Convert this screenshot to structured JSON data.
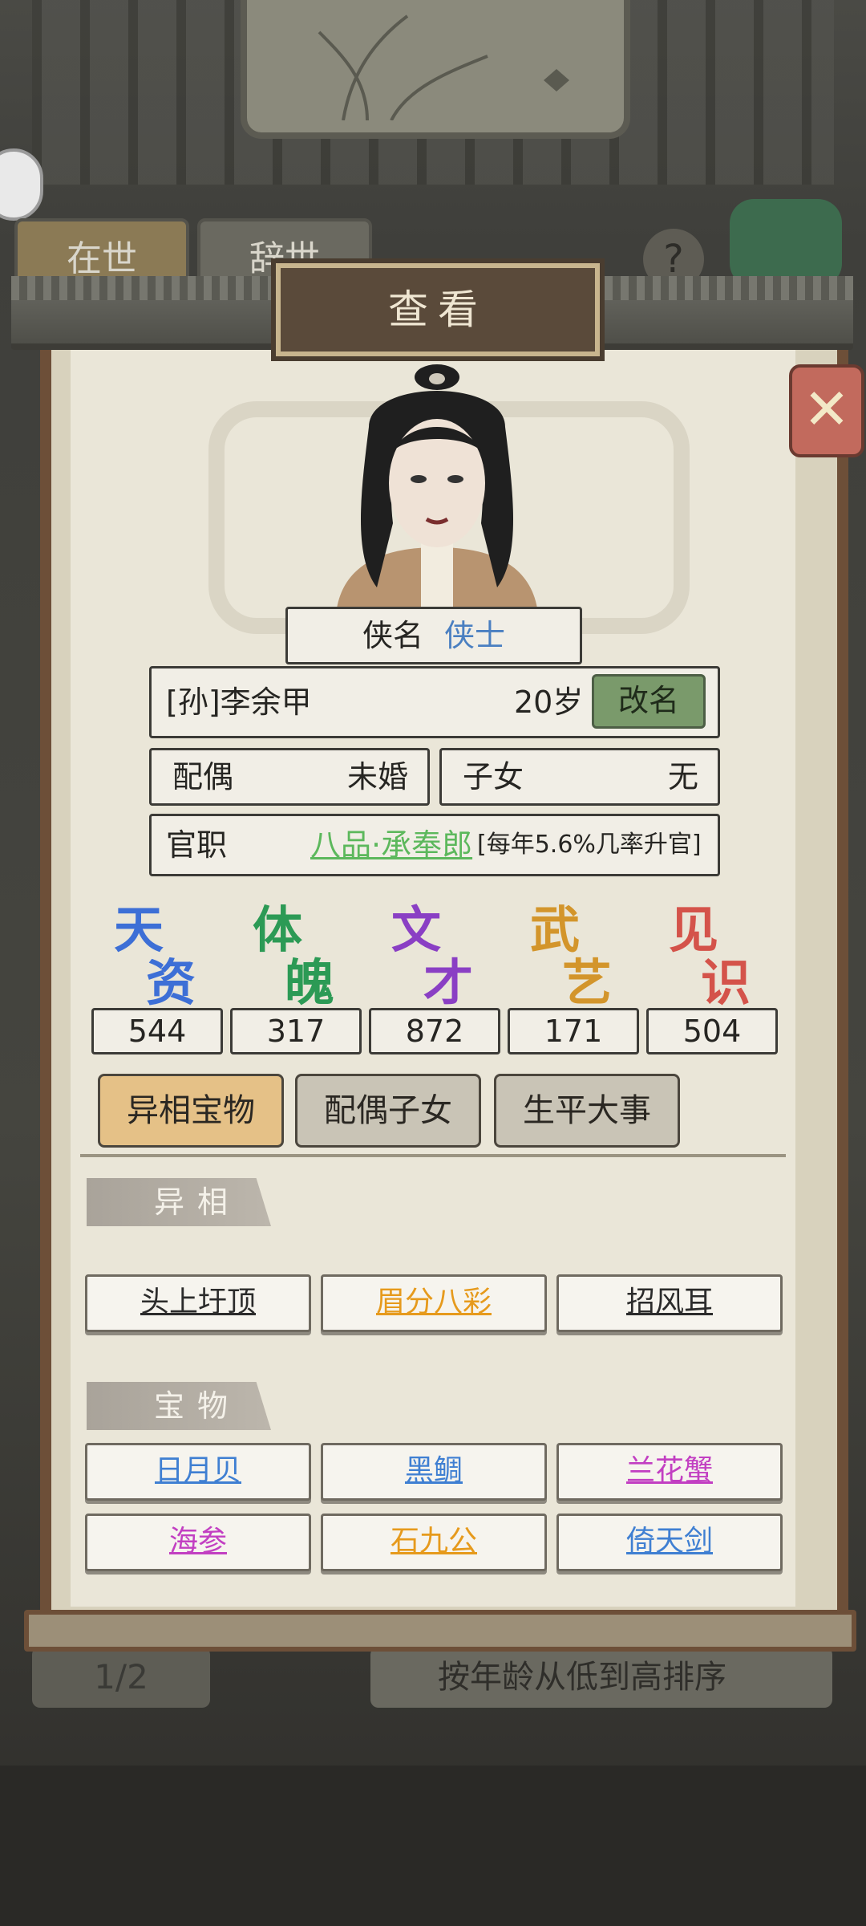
{
  "background": {
    "tab_alive": "在世",
    "tab_dead": "辞世",
    "help": "?",
    "pager": "1/2",
    "sort_label": "按年龄从低到高排序"
  },
  "dialog": {
    "title": "查看",
    "close_icon": "close-x-icon"
  },
  "profile": {
    "title_label": "侠名",
    "title_value": "侠士",
    "title_value_color": "#4a7fc1",
    "name": "[孙]李余甲",
    "age": "20岁",
    "rename_label": "改名",
    "spouse_label": "配偶",
    "spouse_value": "未婚",
    "children_label": "子女",
    "children_value": "无",
    "office_label": "官职",
    "office_value": "八品·承奉郎",
    "office_value_color": "#5cb85c",
    "office_note": "[每年5.6%几率升官]"
  },
  "stats": [
    {
      "label_top": "天",
      "label_bottom": "资",
      "value": "544",
      "color": "#3d6fd6"
    },
    {
      "label_top": "体",
      "label_bottom": "魄",
      "value": "317",
      "color": "#2c9a55"
    },
    {
      "label_top": "文",
      "label_bottom": "才",
      "value": "872",
      "color": "#8a3fc4"
    },
    {
      "label_top": "武",
      "label_bottom": "艺",
      "value": "171",
      "color": "#d3952b"
    },
    {
      "label_top": "见",
      "label_bottom": "识",
      "value": "504",
      "color": "#d4534a"
    }
  ],
  "tabs": [
    {
      "label": "异相宝物",
      "active": true
    },
    {
      "label": "配偶子女",
      "active": false
    },
    {
      "label": "生平大事",
      "active": false
    }
  ],
  "sections": {
    "traits_title": "异相",
    "treasures_title": "宝物"
  },
  "traits": [
    {
      "label": "头上圩顶",
      "color": "#2b2b2b"
    },
    {
      "label": "眉分八彩",
      "color": "#e69a1c"
    },
    {
      "label": "招风耳",
      "color": "#2b2b2b"
    }
  ],
  "treasures": [
    {
      "label": "日月贝",
      "color": "#3f7fd2"
    },
    {
      "label": "黑鲷",
      "color": "#3f7fd2"
    },
    {
      "label": "兰花蟹",
      "color": "#c23fc2"
    },
    {
      "label": "海参",
      "color": "#c23fc2"
    },
    {
      "label": "石九公",
      "color": "#e69a1c"
    },
    {
      "label": "倚天剑",
      "color": "#3f7fd2"
    }
  ]
}
